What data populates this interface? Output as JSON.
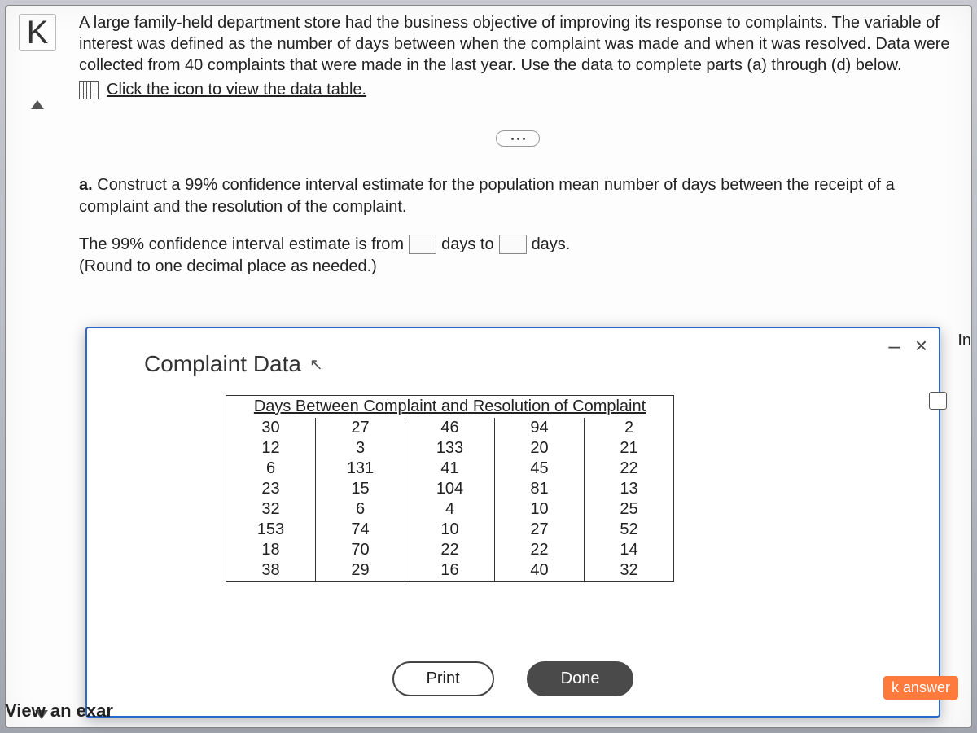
{
  "problem_text": "A large family-held department store had the business objective of improving its response to complaints. The variable of interest was defined as the number of days between when the complaint was made and when it was resolved. Data were collected from 40 complaints that were made in the last year. Use the data to complete parts (a) through (d) below.",
  "data_link_label": "Click the icon to view the data table.",
  "part_a": {
    "label": "a.",
    "text": "Construct a 99% confidence interval estimate for the population mean number of days between the receipt of a complaint and the resolution of the complaint."
  },
  "ci_line": {
    "prefix": "The 99% confidence interval estimate is from",
    "mid": "days to",
    "suffix": "days."
  },
  "round_note": "(Round to one decimal place as needed.)",
  "modal": {
    "title": "Complaint Data",
    "table_header": "Days Between Complaint and Resolution of Complaint",
    "rows": [
      [
        "30",
        "27",
        "46",
        "94",
        "2"
      ],
      [
        "12",
        "3",
        "133",
        "20",
        "21"
      ],
      [
        "6",
        "131",
        "41",
        "45",
        "22"
      ],
      [
        "23",
        "15",
        "104",
        "81",
        "13"
      ],
      [
        "32",
        "6",
        "4",
        "10",
        "25"
      ],
      [
        "153",
        "74",
        "10",
        "27",
        "52"
      ],
      [
        "18",
        "70",
        "22",
        "22",
        "14"
      ],
      [
        "38",
        "29",
        "16",
        "40",
        "32"
      ]
    ],
    "print_label": "Print",
    "done_label": "Done"
  },
  "answer_tag": "k answer",
  "view_example": "View an exar",
  "fragment_in": "In",
  "minimize": "–",
  "close": "×"
}
